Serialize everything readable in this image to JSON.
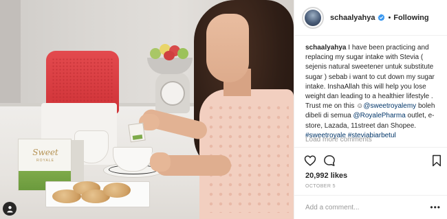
{
  "post_photo": {
    "box_brand": "Sweet",
    "box_subbrand": "ROYALE"
  },
  "header": {
    "username": "schaalyahya",
    "separator": "•",
    "follow_status": "Following"
  },
  "caption": {
    "username": "schaalyahya",
    "text_1": " I have been practicing and replacing my sugar intake with Stevia ( sejenis natural sweetener untuk substitute sugar ) sebab i want to cut down my sugar intake. InshaAllah this will help you lose weight dan leading to a healthier lifestyle . Trust me on this ",
    "emoji": "☺",
    "mention_1": "@sweetroyalemy",
    "text_2": " boleh dibeli di semua ",
    "mention_2": "@RoyalePharma",
    "text_3": " outlet, e-store, Lazada, 11street dan Shopee. ",
    "hashtag_1": "#sweetroyale",
    "hashtag_2": "#steviabiarbetul"
  },
  "load_more": "Load more comments",
  "likes": "20,992 likes",
  "date": "OCTOBER 5",
  "comment": {
    "placeholder": "Add a comment...",
    "more": "•••"
  },
  "icons": {
    "verified": "verified-badge-icon",
    "like": "heart-outline-icon",
    "comment": "speech-bubble-icon",
    "save": "bookmark-outline-icon",
    "tagged_user": "person-icon"
  },
  "colors": {
    "link": "#003569",
    "verified": "#3897f0",
    "muted": "#999999",
    "text": "#262626"
  }
}
